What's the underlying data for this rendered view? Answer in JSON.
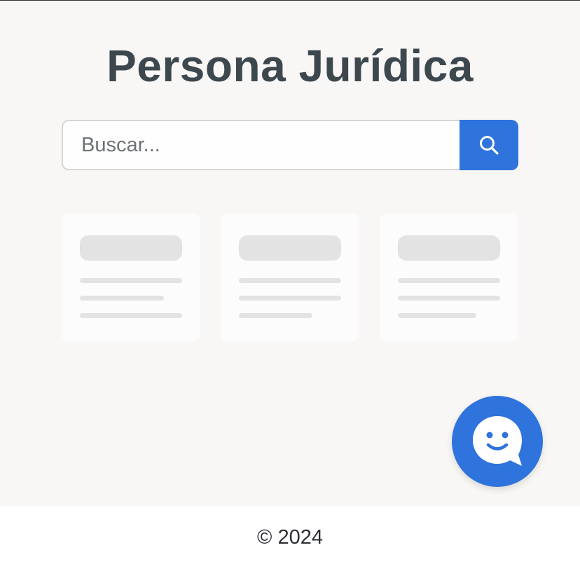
{
  "header": {
    "title": "Persona Jurídica"
  },
  "search": {
    "placeholder": "Buscar...",
    "value": "",
    "button_icon": "search-icon"
  },
  "results": {
    "state": "loading",
    "card_count": 3
  },
  "chat": {
    "icon": "chat-smiley-icon"
  },
  "footer": {
    "text": "© 2024"
  },
  "colors": {
    "accent": "#2f73dc",
    "title": "#3d474e",
    "background": "#f8f7f6",
    "skeleton": "#e3e3e3"
  }
}
